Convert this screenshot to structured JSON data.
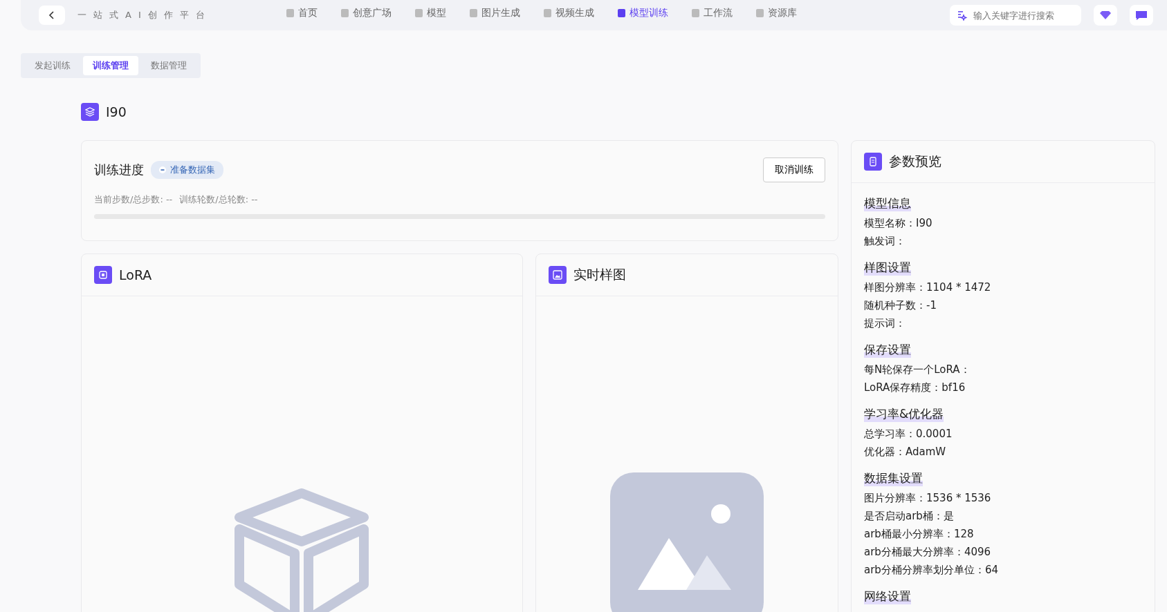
{
  "header": {
    "subtitle": "一站式AI创作平台",
    "nav": [
      {
        "label": "首页",
        "selected": false
      },
      {
        "label": "创意广场",
        "selected": false
      },
      {
        "label": "模型",
        "selected": false
      },
      {
        "label": "图片生成",
        "selected": false
      },
      {
        "label": "视频生成",
        "selected": false
      },
      {
        "label": "模型训练",
        "selected": true
      },
      {
        "label": "工作流",
        "selected": false
      },
      {
        "label": "资源库",
        "selected": false
      }
    ],
    "search": {
      "placeholder": "输入关键字进行搜索"
    }
  },
  "tabs": [
    {
      "label": "发起训练",
      "selected": false
    },
    {
      "label": "训练管理",
      "selected": true
    },
    {
      "label": "数据管理",
      "selected": false
    }
  ],
  "model_title": "I90",
  "progress": {
    "title": "训练进度",
    "status": "准备数据集",
    "cancel_button": "取消训练",
    "steps": "当前步数/总步数: --",
    "epochs": "训练轮数/总轮数: --",
    "level": 0
  },
  "lora_panel": {
    "title": "LoRA"
  },
  "sample_panel": {
    "title": "实时样图"
  },
  "params": {
    "title": "参数预览",
    "sections": [
      {
        "heading": "模型信息",
        "items": [
          "模型名称：I90",
          "触发词："
        ]
      },
      {
        "heading": "样图设置",
        "items": [
          "样图分辨率：1104 * 1472",
          "随机种子数：-1",
          "提示词："
        ]
      },
      {
        "heading": "保存设置",
        "items": [
          "每N轮保存一个LoRA：",
          "LoRA保存精度：bf16"
        ]
      },
      {
        "heading": "学习率&优化器",
        "items": [
          "总学习率：0.0001",
          "优化器：AdamW"
        ]
      },
      {
        "heading": "数据集设置",
        "items": [
          "图片分辨率：1536 * 1536",
          "是否启动arb桶：是",
          "arb桶最小分辨率：128",
          "arb分桶最大分辨率：4096",
          "arb分桶分辨率划分单位：64"
        ]
      },
      {
        "heading": "网络设置"
      }
    ]
  }
}
